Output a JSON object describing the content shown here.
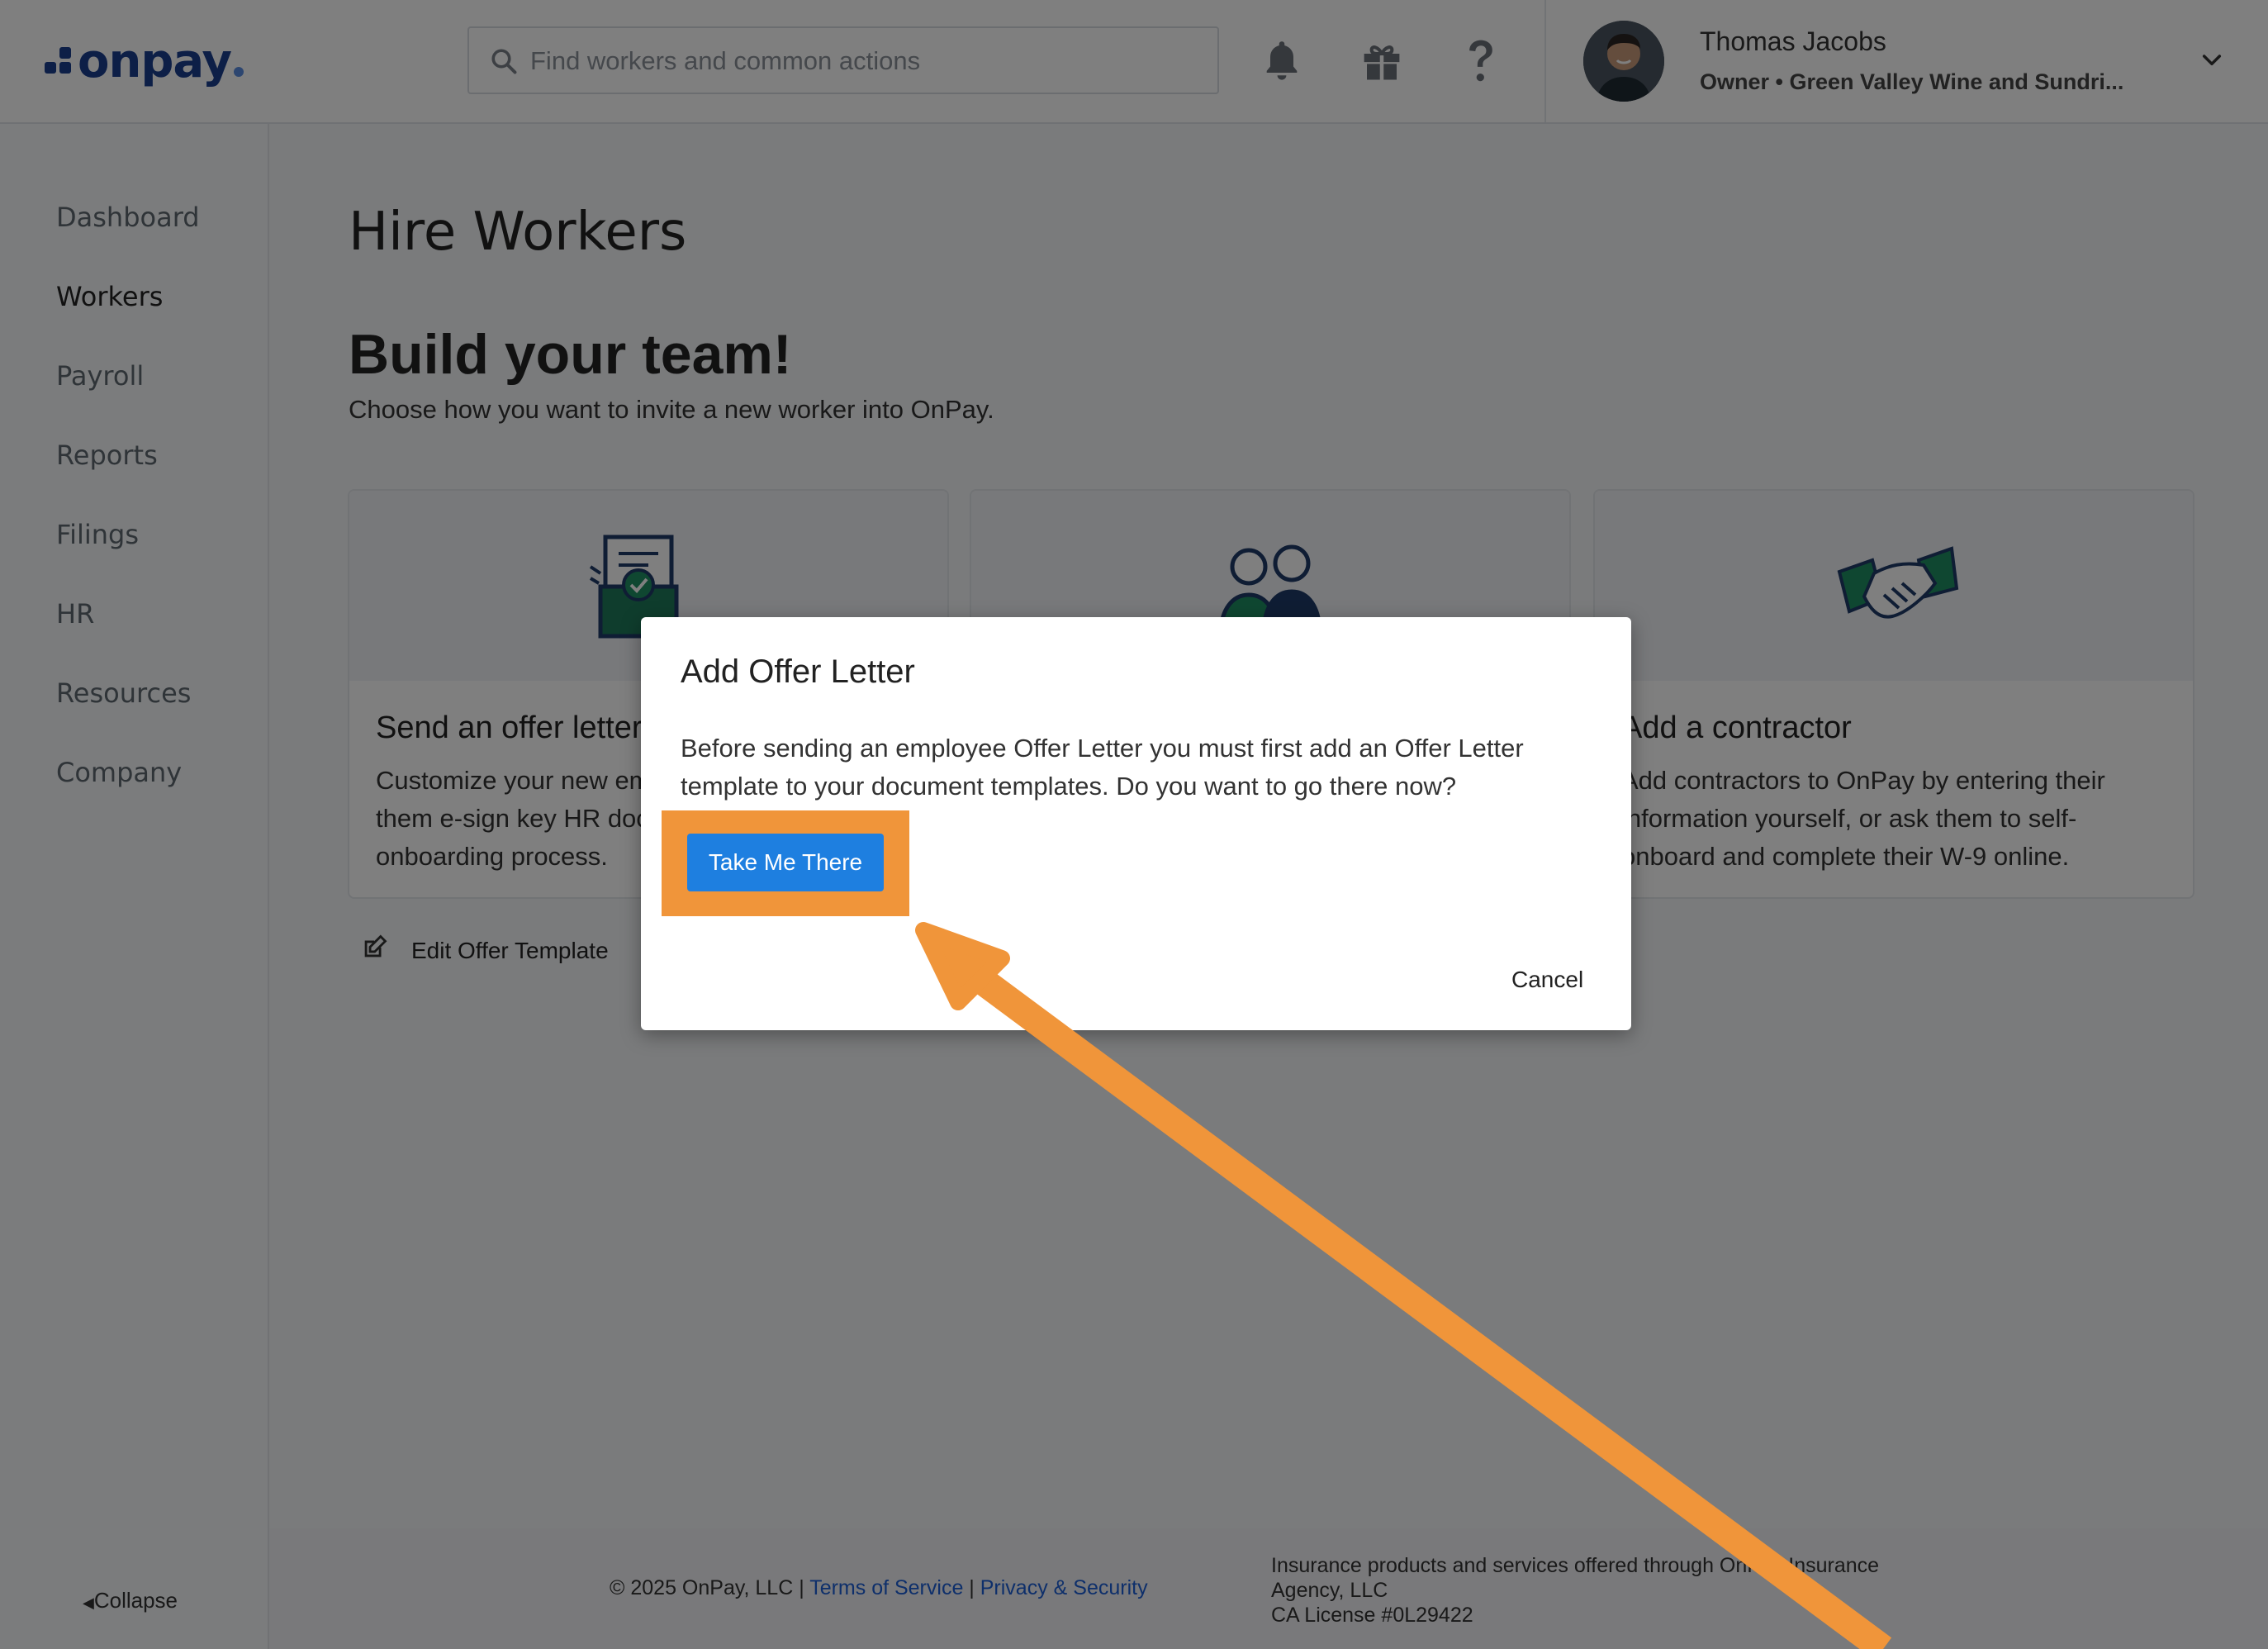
{
  "header": {
    "logo_text": "onpay",
    "search_placeholder": "Find workers and common actions",
    "icons": [
      "bell-icon",
      "gift-icon",
      "help-icon"
    ],
    "user_name": "Thomas Jacobs",
    "user_role": "Owner • Green Valley Wine and Sundri..."
  },
  "sidebar": {
    "items": [
      {
        "label": "Dashboard",
        "active": false
      },
      {
        "label": "Workers",
        "active": true
      },
      {
        "label": "Payroll",
        "active": false
      },
      {
        "label": "Reports",
        "active": false
      },
      {
        "label": "Filings",
        "active": false
      },
      {
        "label": "HR",
        "active": false
      },
      {
        "label": "Resources",
        "active": false
      },
      {
        "label": "Company",
        "active": false
      }
    ],
    "collapse_label": "Collapse"
  },
  "main": {
    "page_title": "Hire Workers",
    "heading": "Build your team!",
    "subheading": "Choose how you want to invite a new worker into OnPay.",
    "cards": [
      {
        "title": "Send an offer letter",
        "desc": "Customize your new employee offer letter, let them e-sign key HR documents and start the onboarding process."
      },
      {
        "title": "",
        "desc": ""
      },
      {
        "title": "Add a contractor",
        "desc": "Add contractors to OnPay by entering their information yourself, or ask them to self-onboard and complete their W-9 online."
      }
    ],
    "edit_template_label": "Edit Offer Template"
  },
  "footer": {
    "copyright": "© 2025 OnPay, LLC | ",
    "terms": "Terms of Service",
    "sep": " | ",
    "privacy": "Privacy & Security",
    "insurance_line1": "Insurance products and services offered through OnPay Insurance",
    "insurance_line2": "Agency, LLC",
    "insurance_line3": "CA License #0L29422"
  },
  "dialog": {
    "title": "Add Offer Letter",
    "body": "Before sending an employee Offer Letter you must first add an Offer Letter template to your document templates. Do you want to go there now?",
    "primary_label": "Take Me There",
    "cancel_label": "Cancel"
  },
  "colors": {
    "brand": "#1b3f8f",
    "primary_button": "#1e7fe0",
    "highlight": "#f0953a",
    "link": "#1c5fd6"
  }
}
